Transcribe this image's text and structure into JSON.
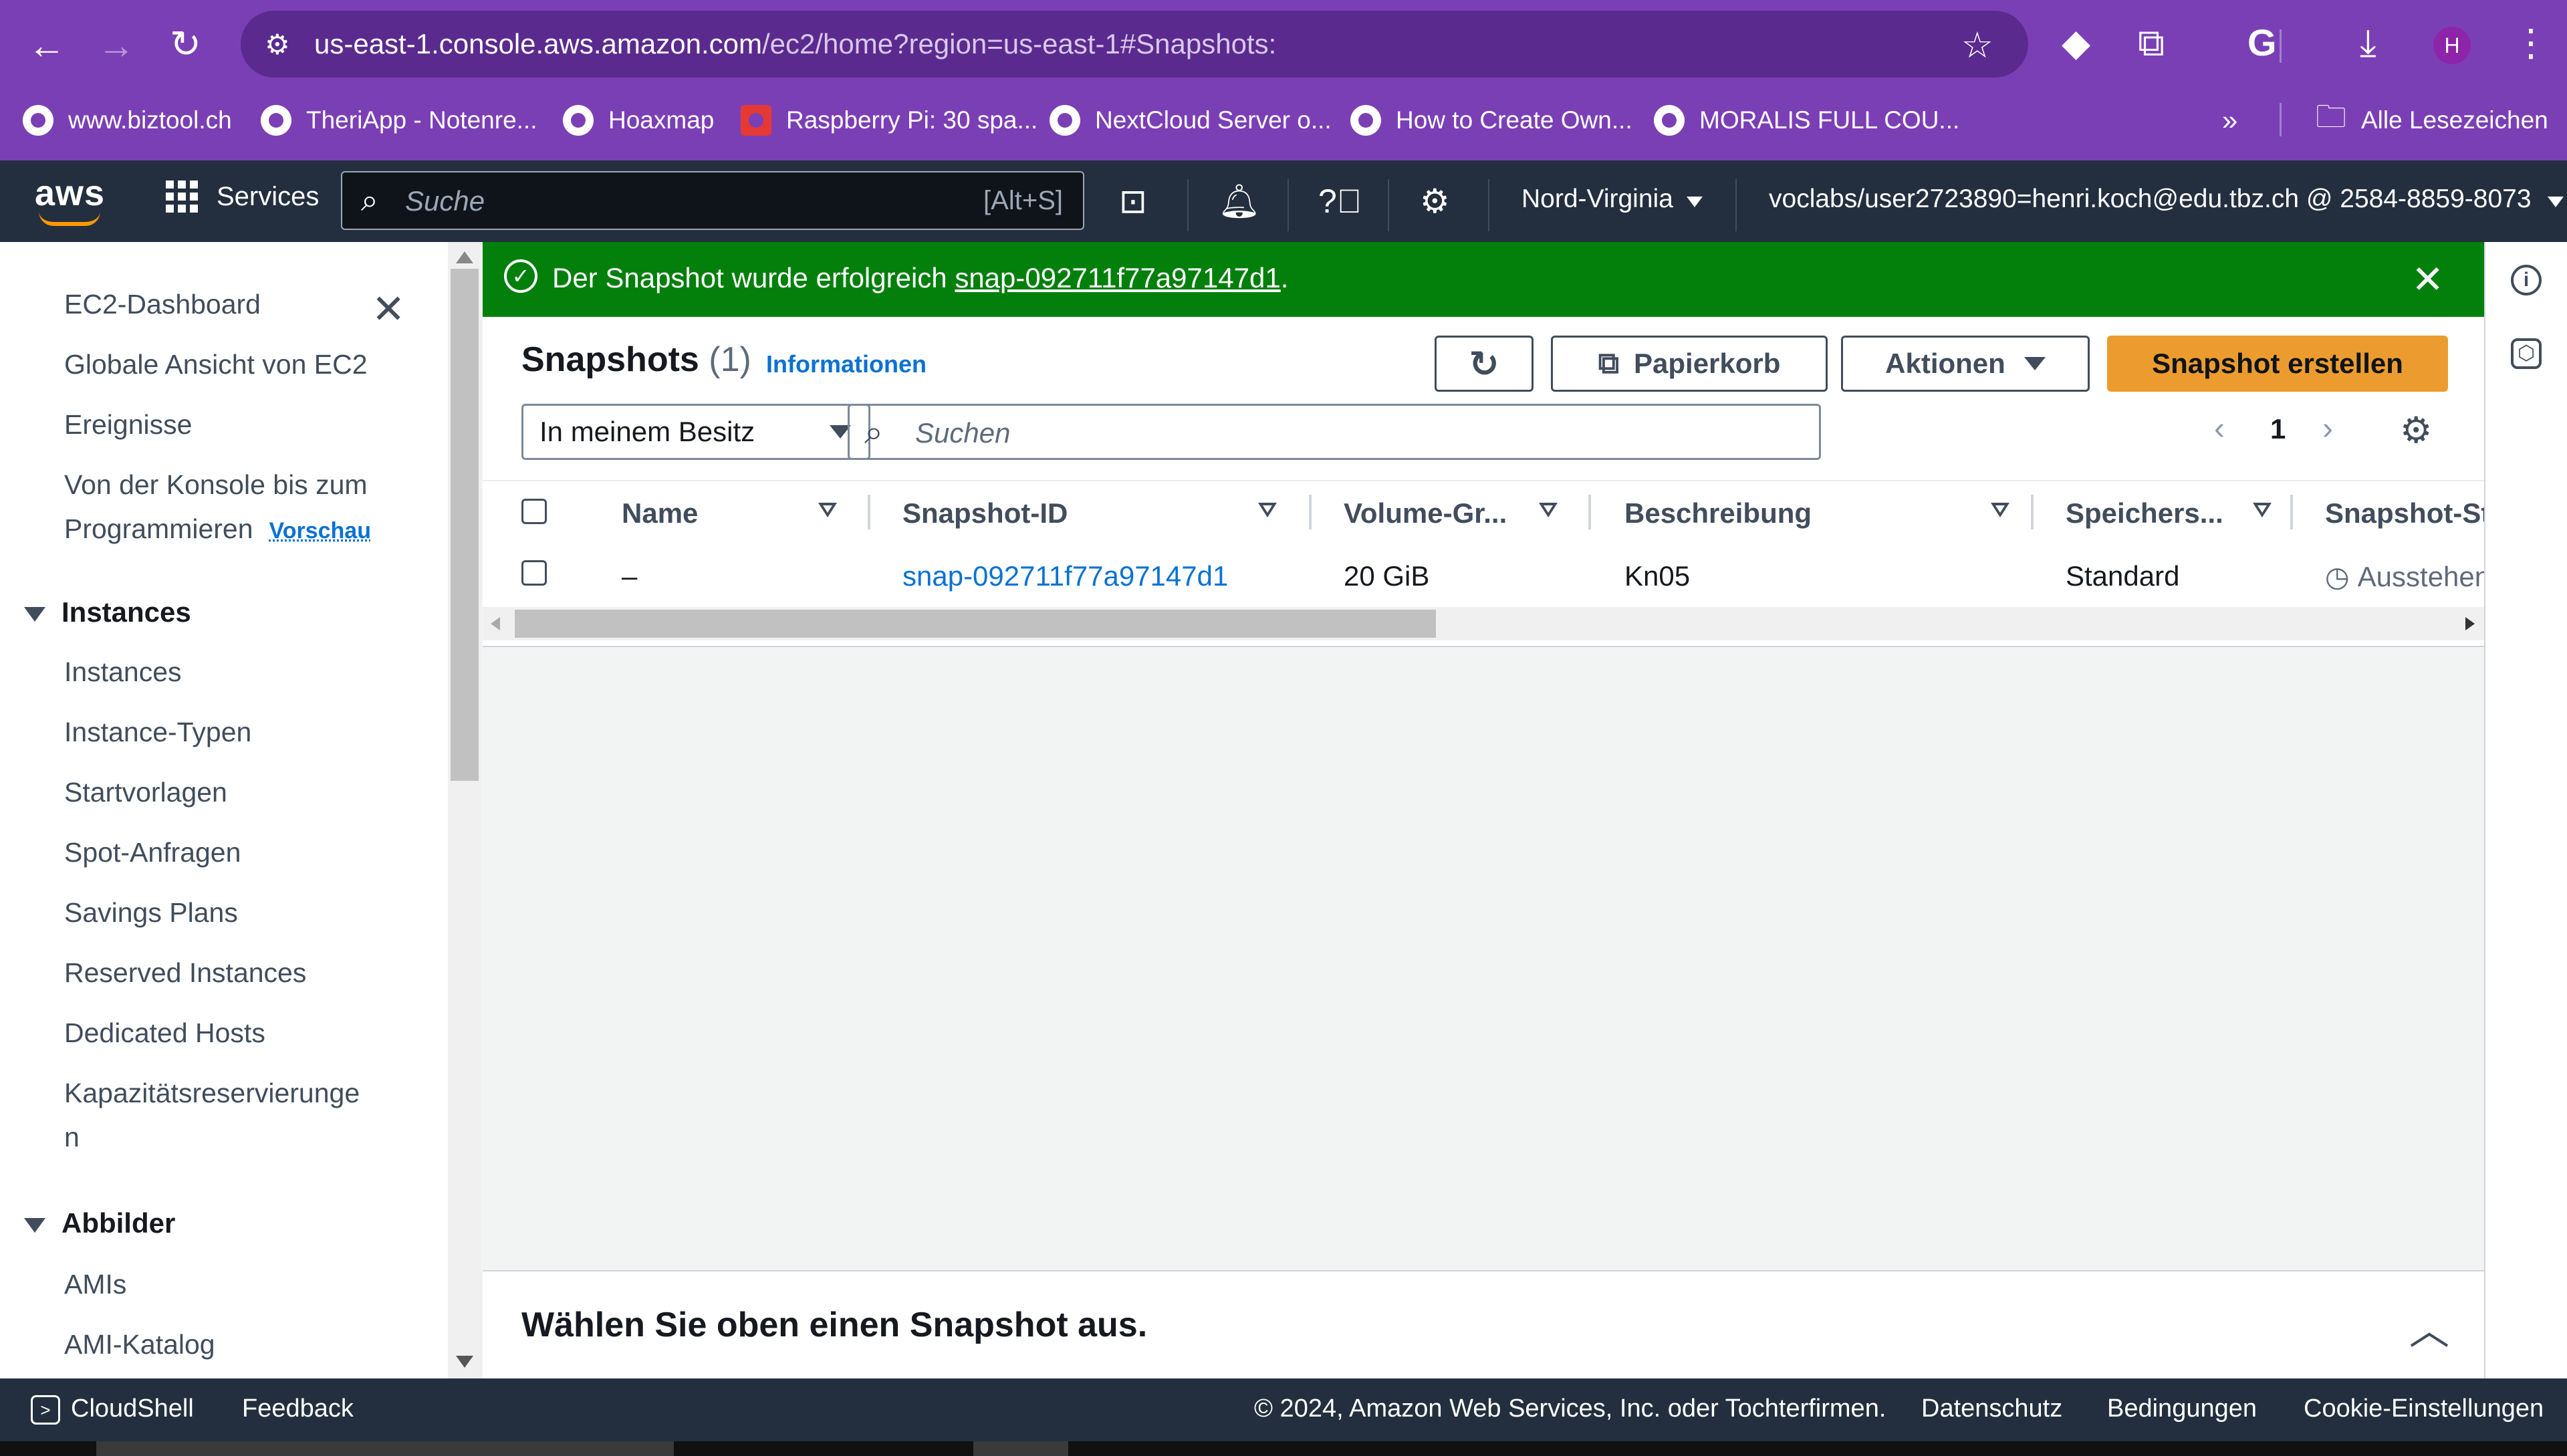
{
  "browser": {
    "url_host": "us-east-1.console.aws.amazon.com",
    "url_path": "/ec2/home?region=us-east-1#Snapshots:",
    "profile_initial": "H",
    "bookmarks": [
      "www.biztool.ch",
      "TheriApp - Notenre...",
      "Hoaxmap",
      "Raspberry Pi: 30 spa...",
      "NextCloud Server o...",
      "How to Create Own...",
      "MORALIS FULL COU..."
    ],
    "all_bookmarks_label": "Alle Lesezeichen"
  },
  "aws_nav": {
    "logo": "aws",
    "services_label": "Services",
    "search_placeholder": "Suche",
    "search_shortcut": "[Alt+S]",
    "region": "Nord-Virginia",
    "account": "voclabs/user2723890=henri.koch@edu.tbz.ch @ 2584-8859-8073"
  },
  "sidebar": {
    "items_top": [
      "EC2-Dashboard",
      "Globale Ansicht von EC2",
      "Ereignisse"
    ],
    "konsole_line1": "Von der Konsole bis zum",
    "konsole_line2": "Programmieren",
    "preview_badge": "Vorschau",
    "section_instances": "Instances",
    "instances_items": [
      "Instances",
      "Instance-Typen",
      "Startvorlagen",
      "Spot-Anfragen",
      "Savings Plans",
      "Reserved Instances",
      "Dedicated Hosts"
    ],
    "kapazitaet_line1": "Kapazitätsreservierunge",
    "kapazitaet_line2": "n",
    "section_images": "Abbilder",
    "images_items": [
      "AMIs",
      "AMI-Katalog"
    ]
  },
  "flash": {
    "text": "Der Snapshot wurde erfolgreich",
    "snapshot_link": "snap-092711f77a97147d1",
    "suffix": "."
  },
  "snapshots": {
    "title": "Snapshots",
    "count": "(1)",
    "info_link": "Informationen",
    "recycle_bin_label": "Papierkorb",
    "actions_label": "Aktionen",
    "create_label": "Snapshot erstellen",
    "owner_filter": "In meinem Besitz",
    "search_placeholder": "Suchen",
    "page": "1",
    "columns": [
      "Name",
      "Snapshot-ID",
      "Volume-Gr...",
      "Beschreibung",
      "Speichers...",
      "Snapshot-St"
    ],
    "rows": [
      {
        "name": "–",
        "snapshot_id": "snap-092711f77a97147d1",
        "volume_size": "20 GiB",
        "description": "Kn05",
        "storage_tier": "Standard",
        "status": "Ausstehen"
      }
    ]
  },
  "details": {
    "prompt": "Wählen Sie oben einen Snapshot aus."
  },
  "footer": {
    "cloudshell": "CloudShell",
    "feedback": "Feedback",
    "copyright": "© 2024, Amazon Web Services, Inc. oder Tochterfirmen.",
    "privacy": "Datenschutz",
    "terms": "Bedingungen",
    "cookies": "Cookie-Einstellungen"
  },
  "colors": {
    "browser_purple": "#7b3fb5",
    "aws_nav": "#232f3e",
    "success_green": "#037f0c",
    "primary_orange": "#ec9c2e",
    "link_blue": "#0972d3"
  }
}
